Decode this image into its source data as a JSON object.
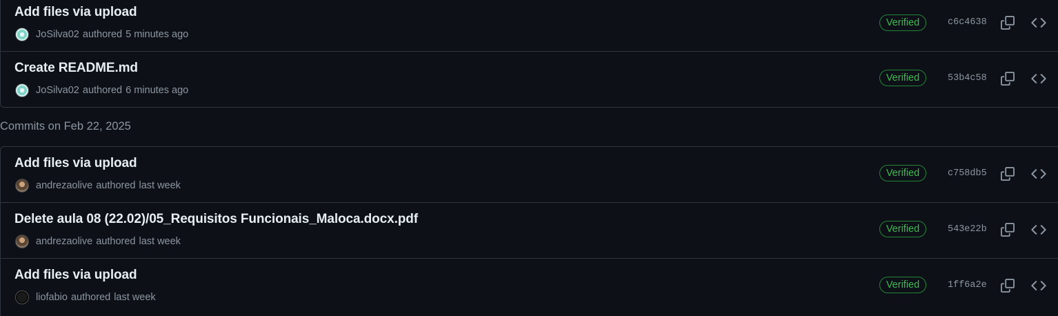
{
  "groups": [
    {
      "header": "",
      "commits": [
        {
          "message": "Add files via upload",
          "author": "JoSilva02",
          "action": "authored",
          "time": "5 minutes ago",
          "badge": "Verified",
          "sha": "c6c4638"
        },
        {
          "message": "Create README.md",
          "author": "JoSilva02",
          "action": "authored",
          "time": "6 minutes ago",
          "badge": "Verified",
          "sha": "53b4c58"
        }
      ]
    },
    {
      "header": "Commits on Feb 22, 2025",
      "commits": [
        {
          "message": "Add files via upload",
          "author": "andrezaolive",
          "action": "authored",
          "time": "last week",
          "badge": "Verified",
          "sha": "c758db5"
        },
        {
          "message": "Delete aula 08 (22.02)/05_Requisitos Funcionais_Maloca.docx.pdf",
          "author": "andrezaolive",
          "action": "authored",
          "time": "last week",
          "badge": "Verified",
          "sha": "543e22b"
        },
        {
          "message": "Add files via upload",
          "author": "liofabio",
          "action": "authored",
          "time": "last week",
          "badge": "Verified",
          "sha": "1ff6a2e"
        }
      ]
    }
  ],
  "icons": {
    "copy": "copy-icon",
    "browse": "code-icon"
  },
  "colors": {
    "background": "#0d1117",
    "border": "#30363d",
    "verified": "#3fb950",
    "muted": "#8d96a0",
    "text": "#e6edf3"
  }
}
